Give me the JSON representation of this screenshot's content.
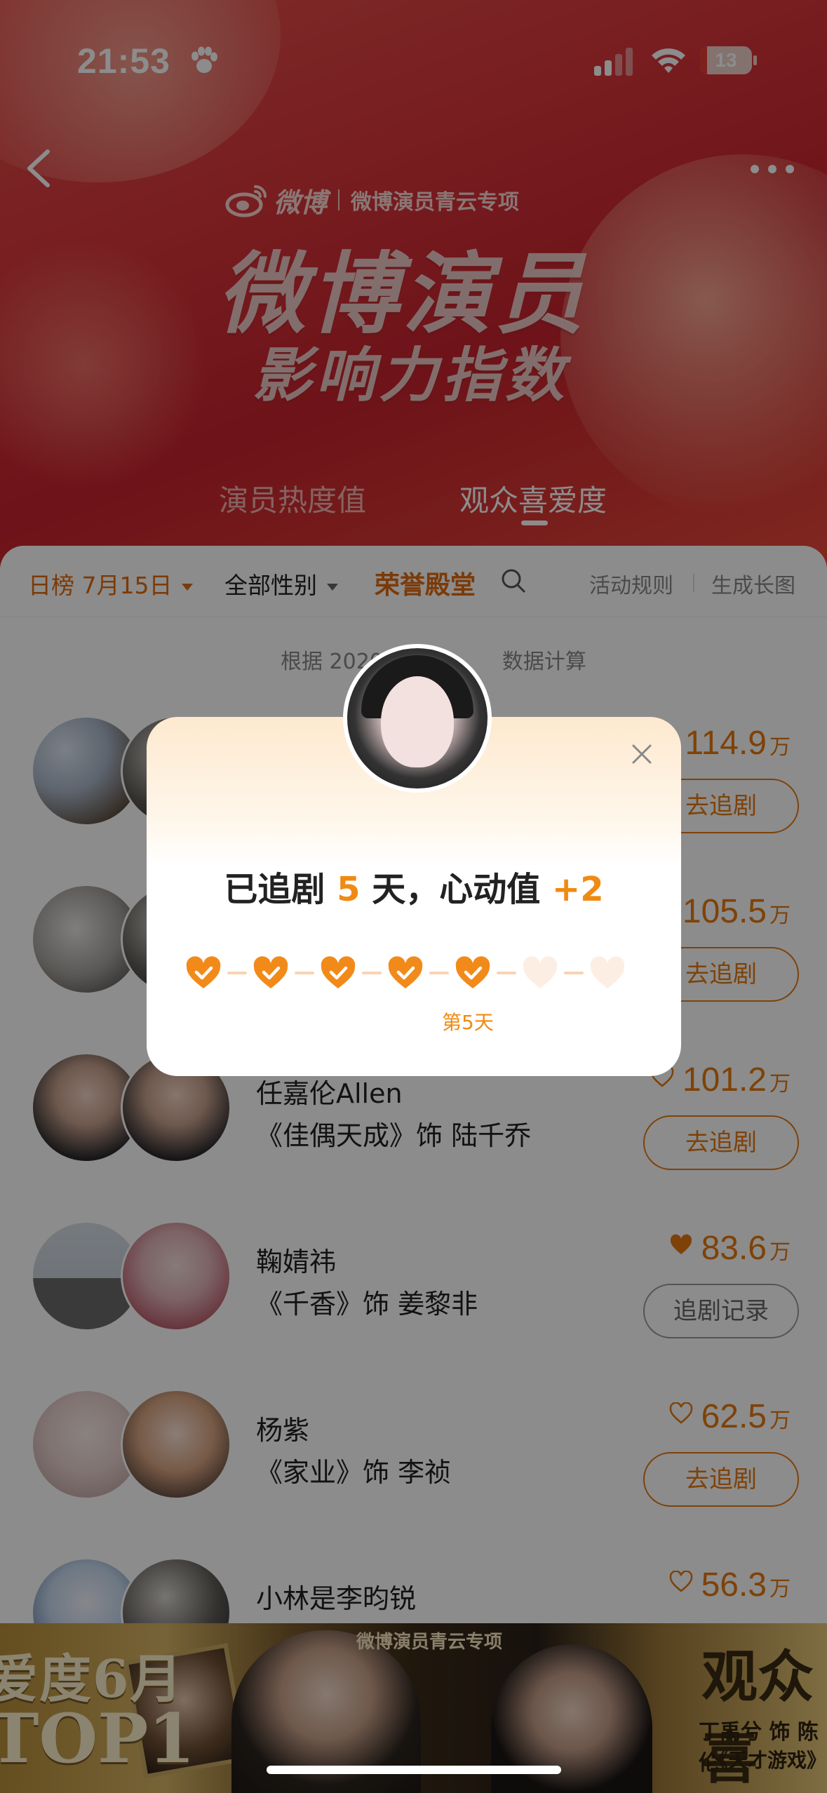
{
  "status_bar": {
    "time": "21:53",
    "battery": "13",
    "battery_level": 0.13
  },
  "header": {
    "brand_logo_text": "微博",
    "brand_subtitle": "微博演员青云专项",
    "title_line1": "微博演员",
    "title_line2": "影响力指数",
    "tabs": [
      {
        "label": "演员热度值",
        "active": false
      },
      {
        "label": "观众喜爱度",
        "active": true
      }
    ]
  },
  "filters": {
    "date": "日榜 7月15日",
    "gender": "全部性别",
    "hall_of_fame": "荣誉殿堂",
    "rules": "活动规则",
    "long_image": "生成长图"
  },
  "note": "根据 2020",
  "note_tail": "数据计算",
  "list": [
    {
      "name": "",
      "role": "",
      "score": "114.9",
      "unit": "万",
      "button": "去追剧",
      "liked": false
    },
    {
      "name": "",
      "role": "",
      "score": "105.5",
      "unit": "万",
      "button": "去追剧",
      "liked": false
    },
    {
      "name": "任嘉伦Allen",
      "role": "《佳偶天成》饰 陆千乔",
      "score": "101.2",
      "unit": "万",
      "button": "去追剧",
      "liked": false
    },
    {
      "name": "鞠婧祎",
      "role": "《千香》饰 姜黎非",
      "score": "83.6",
      "unit": "万",
      "button": "追剧记录",
      "liked": true
    },
    {
      "name": "杨紫",
      "role": "《家业》饰 李祯",
      "score": "62.5",
      "unit": "万",
      "button": "去追剧",
      "liked": false
    },
    {
      "name": "小林是李昀锐",
      "role": "",
      "score": "56.3",
      "unit": "万",
      "button": "",
      "liked": false
    }
  ],
  "popup": {
    "msg_prefix": "已追剧 ",
    "msg_days": "5",
    "msg_mid": " 天，心动值 ",
    "msg_plus": "+2",
    "total_days": 7,
    "completed_days": 5,
    "day_label": "第5天"
  },
  "banner": {
    "left_line1": "爱度6月",
    "left_line2": "TOP1",
    "center_text": "微博演员青云专项",
    "right_line1": "观众喜",
    "right_line2": "丁禹兮 饰 陈伦",
    "right_line3": "《天才游戏》"
  },
  "colors": {
    "accent": "#e6780f",
    "hero_red": "#d9353a",
    "popup_orange": "#f08a12"
  }
}
